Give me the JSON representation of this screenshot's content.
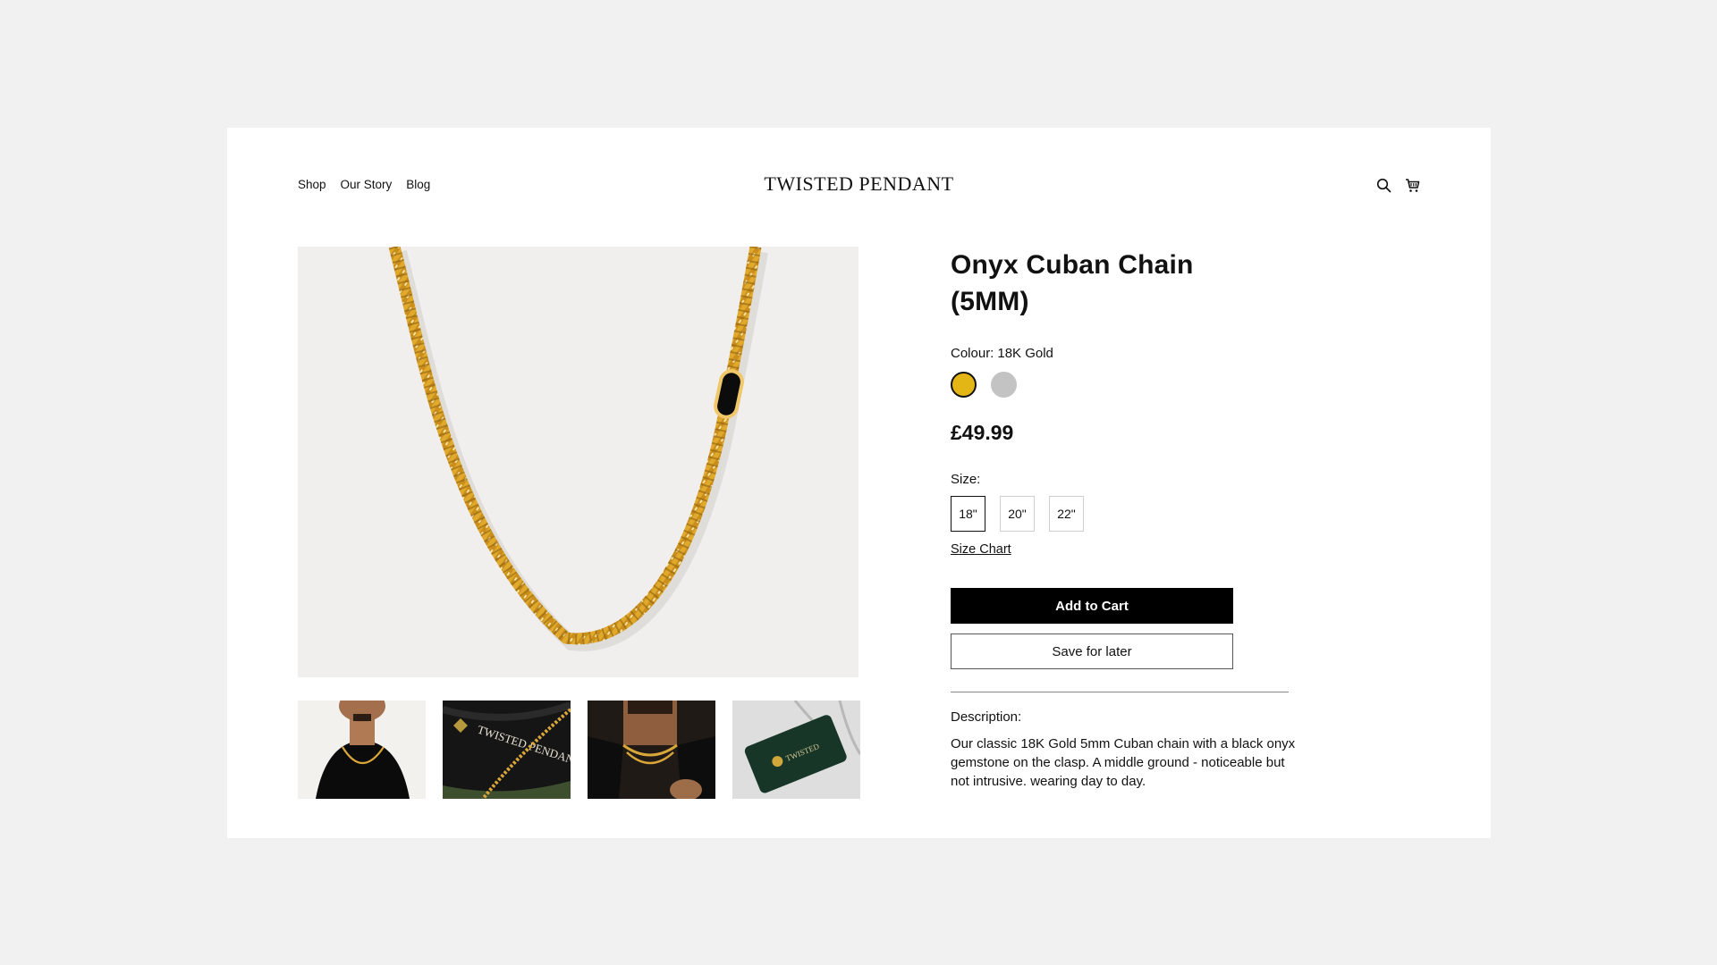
{
  "header": {
    "nav": [
      "Shop",
      "Our Story",
      "Blog"
    ],
    "brand": "TWISTED PENDANT",
    "icons": [
      "search-icon",
      "cart-icon"
    ]
  },
  "gallery": {
    "main_image": "gold-cuban-chain-with-onyx-clasp",
    "thumbnails": [
      "model-wearing-chain",
      "branded-leather-pouch",
      "model-wearing-chain-closeup",
      "green-pouch-with-chain"
    ],
    "thumb_text": "TWISTED PENDANT"
  },
  "product": {
    "title": "Onyx Cuban Chain (5MM)",
    "colour_label": "Colour:",
    "colour_value": "18K Gold",
    "colours": [
      {
        "name": "18K Gold",
        "hex": "#e4b615",
        "selected": true
      },
      {
        "name": "Silver",
        "hex": "#c3c3c3",
        "selected": false
      }
    ],
    "price": "£49.99",
    "size_label": "Size:",
    "sizes": [
      "18\"",
      "20\"",
      "22\""
    ],
    "selected_size": "18\"",
    "size_chart_link": "Size Chart",
    "add_to_cart": "Add to Cart",
    "save_for_later": "Save for later",
    "description_label": "Description:",
    "description": "Our classic 18K Gold 5mm Cuban chain with a black onyx gemstone on the clasp. A middle ground - noticeable but not intrusive. wearing day to day."
  },
  "colors": {
    "page_bg": "#f1f1f1",
    "card_bg": "#ffffff",
    "accent": "#000000",
    "gold": "#e4b615"
  }
}
